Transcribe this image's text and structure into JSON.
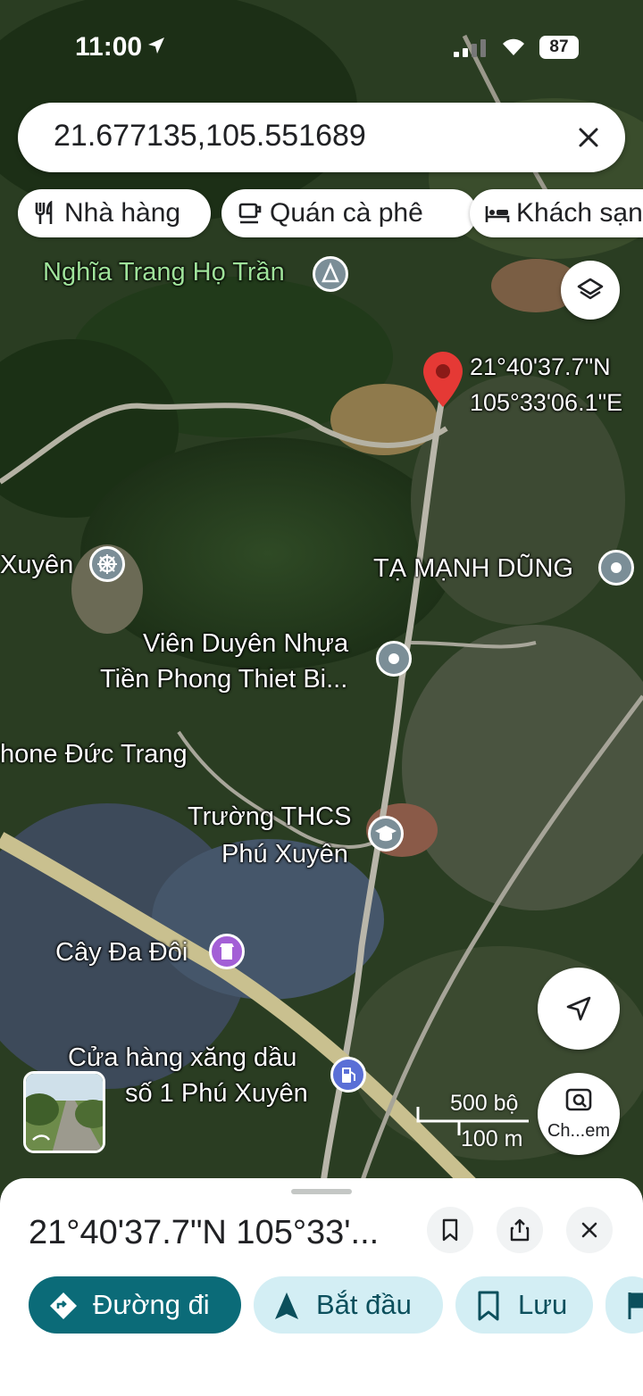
{
  "status_bar": {
    "time": "11:00",
    "battery": "87"
  },
  "search": {
    "query": "21.677135,105.551689"
  },
  "chips": [
    {
      "label": "Nhà hàng",
      "icon": "restaurant-icon"
    },
    {
      "label": "Quán cà phê",
      "icon": "coffee-icon"
    },
    {
      "label": "Khách sạn",
      "icon": "hotel-icon"
    }
  ],
  "map": {
    "pin": {
      "lat": "21°40'37.7\"N",
      "lon": "105°33'06.1\"E"
    },
    "places": [
      {
        "name": "Nghĩa Trang Họ Trần",
        "icon": "cemetery-icon"
      },
      {
        "name": "Xuyên",
        "icon": "dharma-wheel-icon"
      },
      {
        "name": "TẠ MẠNH DŨNG",
        "icon": "place-icon"
      },
      {
        "name_line1": "Viên Duyên Nhựa",
        "name_line2": "Tiền Phong Thiet Bi...",
        "icon": "place-icon"
      },
      {
        "name": "hone Đức Trang"
      },
      {
        "name_line1": "Trường THCS",
        "name_line2": "Phú Xuyên",
        "icon": "school-icon"
      },
      {
        "name": "Cây Đa Đôi",
        "icon": "landmark-icon"
      },
      {
        "name_line1": "Cửa hàng xăng dầu",
        "name_line2": "số 1 Phú Xuyên",
        "icon": "gas-station-icon"
      }
    ],
    "scale": {
      "imperial": "500 bộ",
      "metric": "100 m"
    },
    "lens_label": "Ch...em"
  },
  "sheet": {
    "title": "21°40'37.7\"N 105°33'...",
    "actions": [
      {
        "label": "Đường đi",
        "icon": "directions-icon"
      },
      {
        "label": "Bắt đầu",
        "icon": "navigation-icon"
      },
      {
        "label": "Lưu",
        "icon": "bookmark-icon"
      }
    ]
  },
  "colors": {
    "pin": "#e53935",
    "primary": "#0b6b78",
    "secondary_bg": "#d3eef4",
    "poi_grey": "#7b8e97",
    "poi_purple": "#a35fd6",
    "poi_blue": "#5a6fd6"
  }
}
